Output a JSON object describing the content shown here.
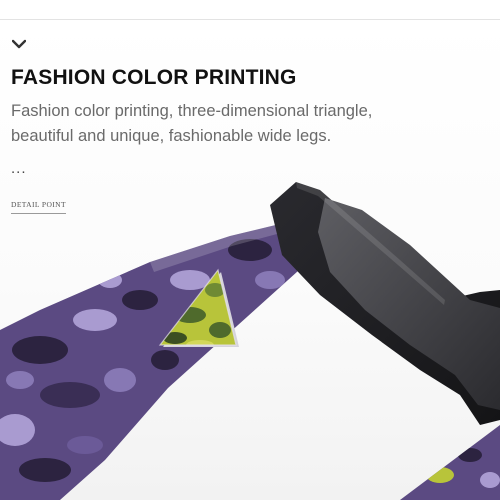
{
  "header": {
    "title": "FASHION COLOR PRINTING",
    "description": "Fashion color printing, three-dimensional triangle, beautiful and unique, fashionable wide legs.",
    "ellipsis": "...",
    "detail_label": "DETAIL POINT"
  },
  "icons": {
    "collapse": "chevron-down-icon"
  },
  "colors": {
    "frame": "#1e1e22",
    "temple_purple": "#5b4a82",
    "camo_dark": "#2c2340",
    "camo_light": "#a99bd0",
    "logo_yellow": "#b8c43a",
    "logo_green": "#4f6a2c"
  }
}
